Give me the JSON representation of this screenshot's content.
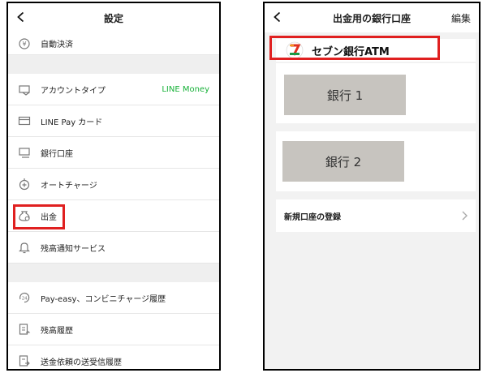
{
  "left": {
    "header_title": "設定",
    "rows": [
      {
        "label": "自動決済",
        "icon": "yen-coin-icon"
      },
      {
        "label": "アカウントタイプ",
        "value": "LINE Money",
        "icon": "account-type-icon"
      },
      {
        "label": "LINE Pay カード",
        "icon": "card-icon"
      },
      {
        "label": "銀行口座",
        "icon": "bank-account-icon"
      },
      {
        "label": "オートチャージ",
        "icon": "auto-charge-icon"
      },
      {
        "label": "出金",
        "icon": "withdraw-bag-icon"
      },
      {
        "label": "残高通知サービス",
        "icon": "bell-icon"
      },
      {
        "label": "Pay-easy、コンビニチャージ履歴",
        "icon": "clock-24-icon"
      },
      {
        "label": "残高履歴",
        "icon": "balance-history-icon"
      },
      {
        "label": "送金依頼の送受信履歴",
        "icon": "transfer-history-icon"
      }
    ],
    "accent_color": "#19b23a",
    "highlight_color": "#e02020"
  },
  "right": {
    "header_title": "出金用の銀行口座",
    "edit_label": "編集",
    "atm_name": "セブン銀行ATM",
    "banks": [
      "銀行 1",
      "銀行 2"
    ],
    "new_account_label": "新規口座の登録"
  }
}
